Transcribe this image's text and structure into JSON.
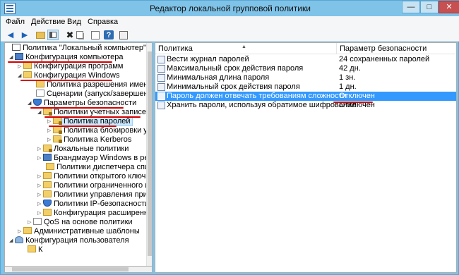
{
  "window": {
    "title": "Редактор локальной групповой политики",
    "controls": {
      "minimize": "—",
      "maximize": "□",
      "close": "✕"
    }
  },
  "menu": [
    "Файл",
    "Действие",
    "Вид",
    "Справка"
  ],
  "toolbar": {
    "back": "◀",
    "forward": "▶",
    "delete": "✖",
    "help": "?"
  },
  "tree": {
    "items": [
      {
        "label": "Политика \"Локальный компьютер\"",
        "arrow": "",
        "icon": "policy-icon",
        "underlined": false,
        "selected": false
      },
      {
        "label": "Конфигурация компьютера",
        "arrow": "◢",
        "icon": "computer-icon",
        "underlined": true,
        "selected": false
      },
      {
        "label": "Конфигурация программ",
        "arrow": "▷",
        "icon": "folder-icon",
        "underlined": false,
        "selected": false
      },
      {
        "label": "Конфигурация Windows",
        "arrow": "◢",
        "icon": "folder-icon",
        "underlined": true,
        "selected": false
      },
      {
        "label": "Политика разрешения имен",
        "arrow": "",
        "icon": "folder-icon",
        "underlined": false,
        "selected": false
      },
      {
        "label": "Сценарии (запуск/завершение)",
        "arrow": "",
        "icon": "script-icon",
        "underlined": false,
        "selected": false
      },
      {
        "label": "Параметры безопасности",
        "arrow": "◢",
        "icon": "shield-icon",
        "underlined": true,
        "selected": false
      },
      {
        "label": "Политики учетных записей",
        "arrow": "◢",
        "icon": "folder-lock-icon",
        "underlined": true,
        "selected": false
      },
      {
        "label": "Политика паролей",
        "arrow": "▷",
        "icon": "folder-lock-icon",
        "underlined": true,
        "selected": true
      },
      {
        "label": "Политика блокировки уче",
        "arrow": "▷",
        "icon": "folder-lock-icon",
        "underlined": false,
        "selected": false
      },
      {
        "label": "Политика Kerberos",
        "arrow": "▷",
        "icon": "folder-lock-icon",
        "underlined": false,
        "selected": false
      },
      {
        "label": "Локальные политики",
        "arrow": "▷",
        "icon": "folder-lock-icon",
        "underlined": false,
        "selected": false
      },
      {
        "label": "Брандмауэр Windows в реж",
        "arrow": "▷",
        "icon": "firewall-icon",
        "underlined": false,
        "selected": false
      },
      {
        "label": "Политики диспетчера списка",
        "arrow": "",
        "icon": "folder-icon",
        "underlined": false,
        "selected": false
      },
      {
        "label": "Политики открытого ключа",
        "arrow": "▷",
        "icon": "folder-icon",
        "underlined": false,
        "selected": false
      },
      {
        "label": "Политики ограниченного исп",
        "arrow": "▷",
        "icon": "folder-icon",
        "underlined": false,
        "selected": false
      },
      {
        "label": "Политики управления прилож",
        "arrow": "▷",
        "icon": "folder-icon",
        "underlined": false,
        "selected": false
      },
      {
        "label": "Политики IP-безопасности на",
        "arrow": "▷",
        "icon": "ipsec-icon",
        "underlined": false,
        "selected": false
      },
      {
        "label": "Конфигурация расширенной",
        "arrow": "▷",
        "icon": "folder-icon",
        "underlined": false,
        "selected": false
      },
      {
        "label": "QoS на основе политики",
        "arrow": "▷",
        "icon": "chart-icon",
        "underlined": false,
        "selected": false
      },
      {
        "label": "Административные шаблоны",
        "arrow": "▷",
        "icon": "folder-icon",
        "underlined": false,
        "selected": false
      },
      {
        "label": "Конфигурация пользователя",
        "arrow": "◢",
        "icon": "user-icon",
        "underlined": false,
        "selected": false
      },
      {
        "label": "К",
        "arrow": "",
        "icon": "folder-icon",
        "underlined": false,
        "selected": false
      }
    ]
  },
  "table": {
    "columns": [
      "Политика",
      "Параметр безопасности"
    ],
    "sort_indicator": "▲",
    "rows": [
      {
        "policy": "Вести журнал паролей",
        "value": "24 сохраненных паролей",
        "selected": false
      },
      {
        "policy": "Максимальный срок действия пароля",
        "value": "42 дн.",
        "selected": false
      },
      {
        "policy": "Минимальная длина пароля",
        "value": "1 зн.",
        "selected": false
      },
      {
        "policy": "Минимальный срок действия пароля",
        "value": "1 дн.",
        "selected": false
      },
      {
        "policy": "Пароль должен отвечать требованиям сложности",
        "value": "Отключен",
        "selected": true
      },
      {
        "policy": "Хранить пароли, используя обратимое шифрование",
        "value": "Отключен",
        "selected": false
      }
    ]
  },
  "colors": {
    "annotation_underline": "#d40000",
    "selection": "#3399ff",
    "titlebar": "#7fc3e8"
  }
}
